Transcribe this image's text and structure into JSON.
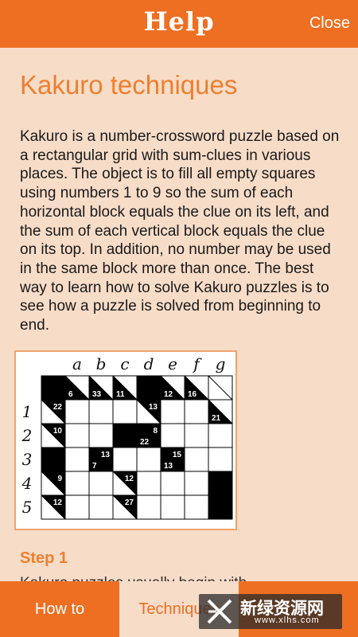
{
  "header": {
    "title": "Help",
    "close_label": "Close"
  },
  "main": {
    "heading": "Kakuro techniques",
    "intro": "Kakuro is a number-crossword puzzle based on a rectangular grid with sum-clues in various places. The object is to fill all empty squares using numbers 1 to 9 so the sum of each horizontal block equals the clue on its left, and the sum of each vertical block equals the clue on its top. In addition, no number may be used in the same block more than once. The best way to learn how to solve Kakuro puzzles is to see how a puzzle is solved from beginning to end.",
    "step_heading": "Step 1",
    "next_text": "Kakuro puzzles usually begin with"
  },
  "puzzle": {
    "columns": [
      "a",
      "b",
      "c",
      "d",
      "e",
      "f",
      "g"
    ],
    "rows": [
      "1",
      "2",
      "3",
      "4",
      "5"
    ],
    "cells": [
      [
        {
          "t": "b"
        },
        {
          "t": "c",
          "d": "6"
        },
        {
          "t": "c",
          "d": "33"
        },
        {
          "t": "c",
          "d": "11"
        },
        {
          "t": "b"
        },
        {
          "t": "c",
          "d": "12"
        },
        {
          "t": "c",
          "d": "16"
        },
        {
          "t": "c"
        }
      ],
      [
        {
          "t": "c",
          "r": "22"
        },
        {
          "t": "w"
        },
        {
          "t": "w"
        },
        {
          "t": "w"
        },
        {
          "t": "c",
          "r": "13"
        },
        {
          "t": "w"
        },
        {
          "t": "w"
        },
        {
          "t": "c",
          "d": "21"
        }
      ],
      [
        {
          "t": "c",
          "r": "10"
        },
        {
          "t": "w"
        },
        {
          "t": "w"
        },
        {
          "t": "b"
        },
        {
          "t": "c",
          "r": "8",
          "d": "22"
        },
        {
          "t": "w"
        },
        {
          "t": "w"
        },
        {
          "t": "w"
        }
      ],
      [
        {
          "t": "b"
        },
        {
          "t": "w"
        },
        {
          "t": "c",
          "r": "13",
          "d": "7"
        },
        {
          "t": "w"
        },
        {
          "t": "w"
        },
        {
          "t": "c",
          "r": "15",
          "d": "13"
        },
        {
          "t": "w"
        },
        {
          "t": "w"
        }
      ],
      [
        {
          "t": "c",
          "r": "9"
        },
        {
          "t": "w"
        },
        {
          "t": "w"
        },
        {
          "t": "c",
          "r": "12"
        },
        {
          "t": "w"
        },
        {
          "t": "w"
        },
        {
          "t": "w"
        },
        {
          "t": "b"
        }
      ],
      [
        {
          "t": "c",
          "r": "12"
        },
        {
          "t": "w"
        },
        {
          "t": "w"
        },
        {
          "t": "c",
          "r": "27"
        },
        {
          "t": "w"
        },
        {
          "t": "w"
        },
        {
          "t": "w"
        },
        {
          "t": "b"
        }
      ]
    ]
  },
  "tabs": {
    "howto_label": "How to",
    "techniques_label": "Techniques"
  },
  "watermark": {
    "line1": "新绿资源网",
    "line2": "www.xlhs.com"
  }
}
